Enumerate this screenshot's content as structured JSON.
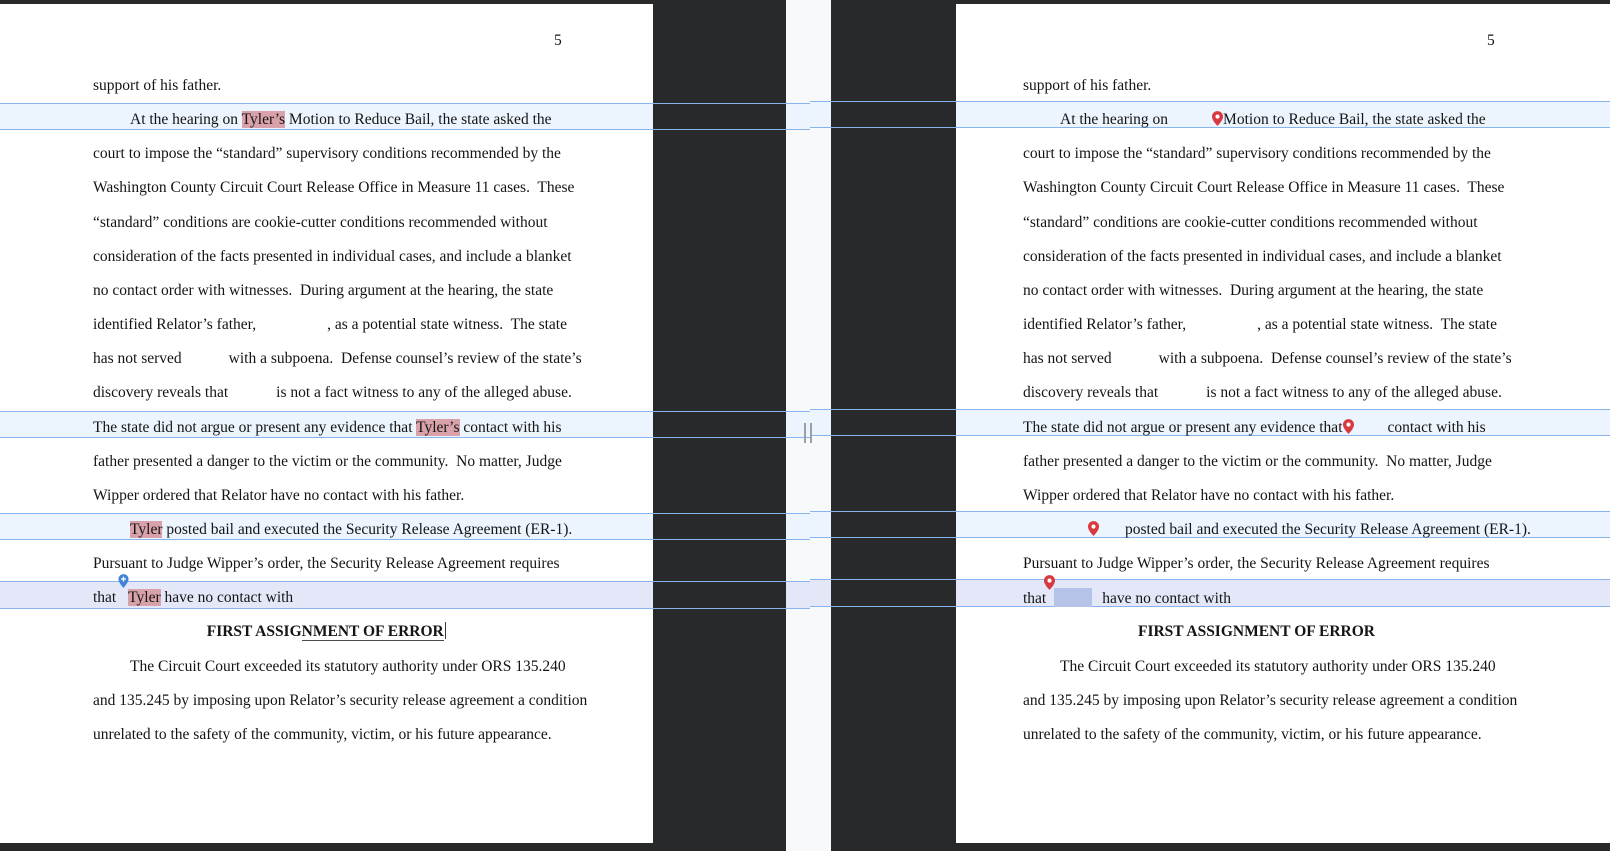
{
  "colors": {
    "viewer_bg": "#27292b",
    "gutter_bg": "#f8f9fa",
    "band_fill": "#ecf4fd",
    "band_fill_selected": "#e3e7f8",
    "band_border": "#88b4ee",
    "name_highlight": "#d9a2aa",
    "redaction_box": "#b6c3e9",
    "pin_red": "#d9383f",
    "pin_blue": "#4083d8",
    "handle": "#9aa0a6"
  },
  "icons": {
    "map_pin": "map-pin-icon",
    "add_pin": "add-pin-icon",
    "splitter": "splitter-handle-icon"
  },
  "left_page": {
    "page_number": "5",
    "lines": [
      {
        "segs": [
          {
            "t": "support of his father."
          }
        ]
      },
      {
        "band": true,
        "indent": true,
        "segs": [
          {
            "t": "At the hearing on "
          },
          {
            "hl": "Tyler’s"
          },
          {
            "t": " Motion to Reduce Bail, the state asked the"
          }
        ]
      },
      {
        "segs": [
          {
            "t": "court to impose the “standard” supervisory conditions recommended by the"
          }
        ]
      },
      {
        "segs": [
          {
            "t": "Washington County Circuit Court Release Office in Measure 11 cases.  These"
          }
        ]
      },
      {
        "segs": [
          {
            "t": "“standard” conditions are cookie-cutter conditions recommended without"
          }
        ]
      },
      {
        "segs": [
          {
            "t": "consideration of the facts presented in individual cases, and include a blanket"
          }
        ]
      },
      {
        "segs": [
          {
            "t": "no contact order with witnesses.  During argument at the hearing, the state"
          }
        ]
      },
      {
        "segs": [
          {
            "t": "identified Relator’s father,"
          },
          {
            "gap": 71
          },
          {
            "t": ", as a potential state witness.  The state"
          }
        ]
      },
      {
        "segs": [
          {
            "t": "has not served"
          },
          {
            "gap": 47
          },
          {
            "t": "with a subpoena.  Defense counsel’s review of the state’s"
          }
        ]
      },
      {
        "segs": [
          {
            "t": "discovery reveals that"
          },
          {
            "gap": 48
          },
          {
            "t": "is not a fact witness to any of the alleged abuse."
          }
        ]
      },
      {
        "band": true,
        "segs": [
          {
            "t": "The state did not argue or present any evidence that "
          },
          {
            "hl": "Tyler’s"
          },
          {
            "t": " contact with his"
          }
        ]
      },
      {
        "segs": [
          {
            "t": "father presented a danger to the victim or the community.  No matter, Judge"
          }
        ]
      },
      {
        "segs": [
          {
            "t": "Wipper ordered that Relator have no contact with his father."
          }
        ]
      },
      {
        "band": true,
        "indent": true,
        "segs": [
          {
            "hl": "Tyler"
          },
          {
            "t": " posted bail and executed the Security Release Agreement (ER-1)."
          }
        ]
      },
      {
        "segs": [
          {
            "t": "Pursuant to Judge Wipper’s order, the Security Release Agreement requires"
          }
        ]
      },
      {
        "band": true,
        "selected": true,
        "segs": [
          {
            "t": "that "
          },
          {
            "icon": "add-pin",
            "lift": true
          },
          {
            "hl": "Tyler"
          },
          {
            "t": " have no contact with"
          }
        ]
      },
      {
        "center": true,
        "bold": true,
        "segs": [
          {
            "t": "FIRST ASSIG"
          },
          {
            "t": "NMENT OF ERROR",
            "u": true
          },
          {
            "caret": true
          }
        ]
      },
      {
        "indent": true,
        "segs": [
          {
            "t": "The Circuit Court exceeded its statutory authority under ORS 135.240"
          }
        ]
      },
      {
        "segs": [
          {
            "t": "and 135.245 by imposing upon Relator’s security release agreement a condition"
          }
        ]
      },
      {
        "segs": [
          {
            "t": "unrelated to the safety of the community, victim, or his future appearance."
          }
        ]
      }
    ]
  },
  "right_page": {
    "page_number": "5",
    "lines": [
      {
        "segs": [
          {
            "t": "support of his father."
          }
        ]
      },
      {
        "band": true,
        "indent": true,
        "segs": [
          {
            "t": "At the hearing on"
          },
          {
            "gap": 44
          },
          {
            "icon": "map-pin"
          },
          {
            "t": "Motion to Reduce Bail, the state asked the"
          }
        ]
      },
      {
        "segs": [
          {
            "t": "court to impose the “standard” supervisory conditions recommended by the"
          }
        ]
      },
      {
        "segs": [
          {
            "t": "Washington County Circuit Court Release Office in Measure 11 cases.  These"
          }
        ]
      },
      {
        "segs": [
          {
            "t": "“standard” conditions are cookie-cutter conditions recommended without"
          }
        ]
      },
      {
        "segs": [
          {
            "t": "consideration of the facts presented in individual cases, and include a blanket"
          }
        ]
      },
      {
        "segs": [
          {
            "t": "no contact order with witnesses.  During argument at the hearing, the state"
          }
        ]
      },
      {
        "segs": [
          {
            "t": "identified Relator’s father,"
          },
          {
            "gap": 71
          },
          {
            "t": ", as a potential state witness.  The state"
          }
        ]
      },
      {
        "segs": [
          {
            "t": "has not served"
          },
          {
            "gap": 47
          },
          {
            "t": "with a subpoena.  Defense counsel’s review of the state’s"
          }
        ]
      },
      {
        "segs": [
          {
            "t": "discovery reveals that"
          },
          {
            "gap": 48
          },
          {
            "t": "is not a fact witness to any of the alleged abuse."
          }
        ]
      },
      {
        "band": true,
        "segs": [
          {
            "t": "The state did not argue or present any evidence that"
          },
          {
            "icon": "map-pin"
          },
          {
            "gap": 34
          },
          {
            "t": "contact with his"
          }
        ]
      },
      {
        "segs": [
          {
            "t": "father presented a danger to the victim or the community.  No matter, Judge"
          }
        ]
      },
      {
        "segs": [
          {
            "t": "Wipper ordered that Relator have no contact with his father."
          }
        ]
      },
      {
        "band": true,
        "indent": true,
        "segs": [
          {
            "gap": 28
          },
          {
            "icon": "map-pin"
          },
          {
            "gap": 26
          },
          {
            "t": "posted bail and executed the Security Release Agreement (ER-1)."
          }
        ]
      },
      {
        "segs": [
          {
            "t": "Pursuant to Judge Wipper’s order, the Security Release Agreement requires"
          }
        ]
      },
      {
        "band": true,
        "selected": true,
        "segs": [
          {
            "t": "that"
          },
          {
            "icon": "map-pin",
            "lift": true
          },
          {
            "box": 38
          },
          {
            "gap": 10
          },
          {
            "t": "have no contact with"
          }
        ]
      },
      {
        "center": true,
        "bold": true,
        "segs": [
          {
            "t": "FIRST ASSIGNMENT OF ERROR"
          }
        ]
      },
      {
        "indent": true,
        "segs": [
          {
            "t": "The Circuit Court exceeded its statutory authority under ORS 135.240"
          }
        ]
      },
      {
        "segs": [
          {
            "t": "and 135.245 by imposing upon Relator’s security release agreement a condition"
          }
        ]
      },
      {
        "segs": [
          {
            "t": "unrelated to the safety of the community, victim, or his future appearance."
          }
        ]
      }
    ]
  }
}
